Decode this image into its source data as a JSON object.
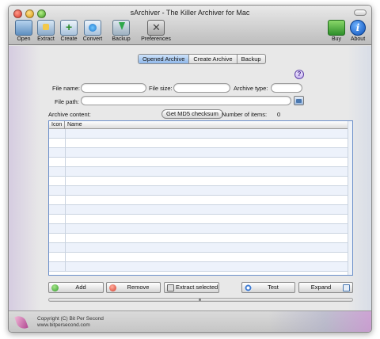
{
  "window": {
    "title": "sArchiver - The Killer Archiver for Mac"
  },
  "toolbar": {
    "open": "Open",
    "extract": "Extract",
    "create": "Create",
    "convert": "Convert",
    "backup": "Backup",
    "preferences": "Preferences",
    "buy": "Buy",
    "about": "About"
  },
  "tabs": [
    "Opened Archive",
    "Create Archive",
    "Backup"
  ],
  "help": {
    "glyph": "?"
  },
  "form": {
    "file_name_label": "File name:",
    "file_size_label": "File size:",
    "archive_type_label": "Archive type:",
    "file_path_label": "File path:",
    "archive_content_label": "Archive content:",
    "md5_button": "Get MD5 checksum",
    "items_label": "Number of items:",
    "items_count": "0"
  },
  "list": {
    "columns": [
      "Icon",
      "Name"
    ]
  },
  "actions": {
    "add": "Add",
    "remove": "Remove",
    "extract_selected": "Extract selected",
    "test": "Test",
    "expand": "Expand"
  },
  "footer": {
    "copyright": "Copyright (C) Bit Per Second",
    "url": "www.bitpersecond.com"
  }
}
